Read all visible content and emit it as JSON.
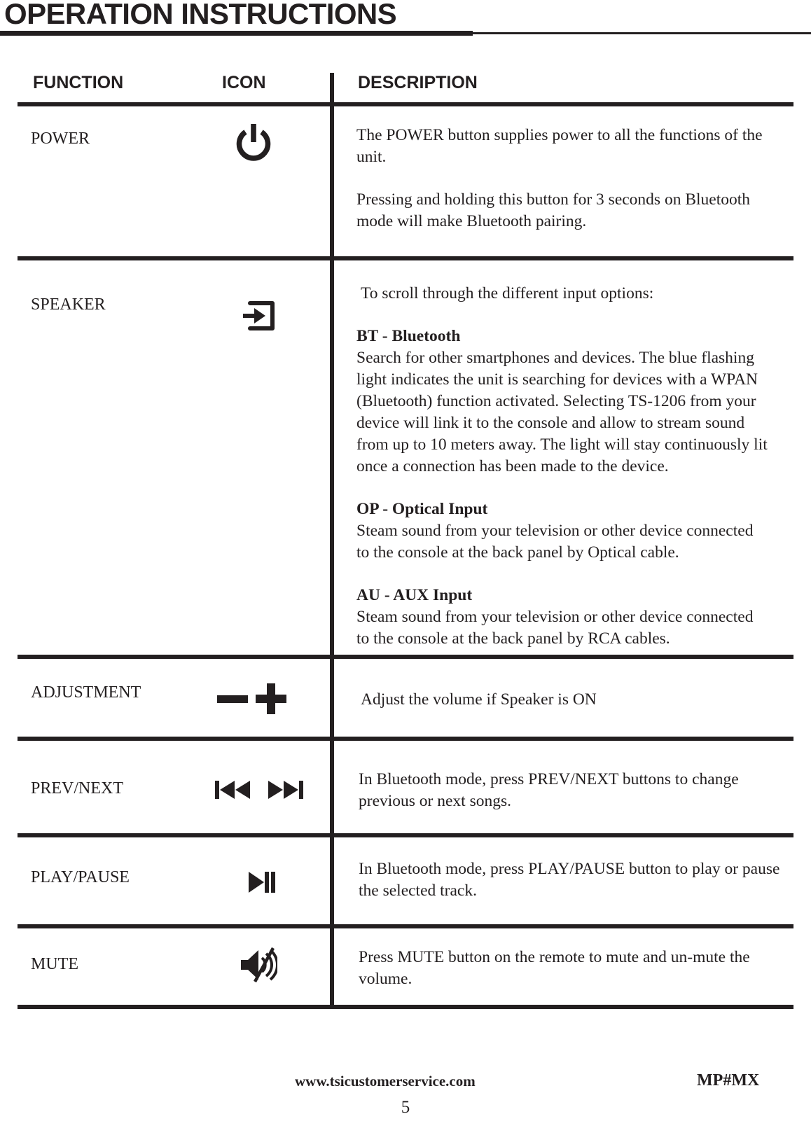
{
  "page": {
    "title": "OPERATION INSTRUCTIONS",
    "number": "5"
  },
  "table": {
    "headers": {
      "function": "FUNCTION",
      "icon": "ICON",
      "description": "DESCRIPTION"
    },
    "rows": [
      {
        "function": "POWER",
        "icon_name": "power-icon",
        "description_blocks": [
          {
            "type": "paragraph",
            "text": "The POWER button supplies power to all the functions of the unit."
          },
          {
            "type": "paragraph",
            "text": "Pressing and holding this button for 3 seconds on Bluetooth mode will make Bluetooth pairing."
          }
        ]
      },
      {
        "function": "SPEAKER",
        "icon_name": "input-arrow-into-box-icon",
        "description_blocks": [
          {
            "type": "paragraph",
            "text": "To scroll through the different input options:"
          },
          {
            "type": "heading",
            "text": "BT - Bluetooth"
          },
          {
            "type": "paragraph",
            "text": "Search for other smartphones and devices. The blue flashing light indicates the unit is searching for devices with a WPAN (Bluetooth) function activated. Selecting TS-1206 from your device will link it to the console and allow to stream sound from up to 10 meters away. The light will stay continuously lit once a connection has been made to the device."
          },
          {
            "type": "heading",
            "text": "OP  - Optical Input"
          },
          {
            "type": "paragraph",
            "text": "Steam sound from your television or other device connected to the console at the back panel by Optical cable."
          },
          {
            "type": "heading",
            "text": "AU  - AUX Input"
          },
          {
            "type": "paragraph",
            "text": "Steam sound from your television or other device connected to the console at the back panel by RCA cables."
          }
        ]
      },
      {
        "function": "ADJUSTMENT",
        "icon_name": "minus-plus-icon",
        "description_blocks": [
          {
            "type": "paragraph",
            "text": "Adjust the volume if Speaker is ON"
          }
        ]
      },
      {
        "function": "PREV/NEXT",
        "icon_name": "prev-next-icon",
        "description_blocks": [
          {
            "type": "paragraph",
            "text": "In Bluetooth mode, press PREV/NEXT buttons to change previous or next songs."
          }
        ]
      },
      {
        "function": "PLAY/PAUSE",
        "icon_name": "play-pause-icon",
        "description_blocks": [
          {
            "type": "paragraph",
            "text": "In Bluetooth mode, press PLAY/PAUSE button to play or pause the selected track."
          }
        ]
      },
      {
        "function": "MUTE",
        "icon_name": "mute-speaker-icon",
        "description_blocks": [
          {
            "type": "paragraph",
            "text": "Press MUTE button on the remote to mute and un-mute the volume."
          }
        ]
      }
    ]
  },
  "footer": {
    "website": "www.tsicustomerservice.com",
    "model": "MP#MX"
  },
  "colors": {
    "ink": "#231f20",
    "paper": "#ffffff"
  }
}
